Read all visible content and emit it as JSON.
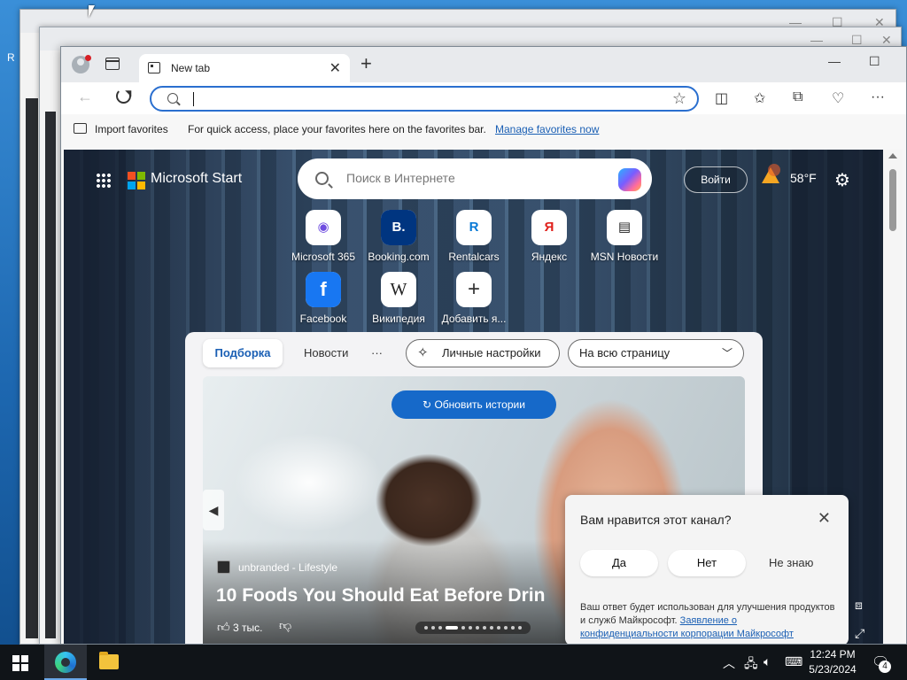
{
  "desktop": {
    "letter": "R"
  },
  "browser": {
    "tab": {
      "title": "New tab",
      "close": "✕"
    },
    "new_tab": "+",
    "window_controls": {
      "minimize": "—",
      "maximize": "☐"
    },
    "address": {
      "value": "",
      "placeholder": ""
    },
    "favorites_bar": {
      "import": "Import favorites",
      "hint": "For quick access, place your favorites here on the favorites bar.",
      "manage_link": "Manage favorites now"
    }
  },
  "msn": {
    "brand": "Microsoft Start",
    "search_placeholder": "Поиск в Интернете",
    "signin": "Войти",
    "weather_temp": "58°F",
    "shortcuts": [
      {
        "label": "Microsoft 365",
        "glyph": "◉",
        "color": "#6f4de0"
      },
      {
        "label": "Booking.com",
        "glyph": "B.",
        "color": "#003580"
      },
      {
        "label": "Rentalcars",
        "glyph": "R",
        "color": "#0a7ad6"
      },
      {
        "label": "Яндекс",
        "glyph": "Я",
        "color": "#e0201b"
      },
      {
        "label": "MSN Новости",
        "glyph": "▤",
        "color": "#222222"
      },
      {
        "label": "Facebook",
        "glyph": "f",
        "color": "#1877f2"
      },
      {
        "label": "Википедия",
        "glyph": "W",
        "color": "#222222"
      },
      {
        "label": "Добавить я...",
        "glyph": "+",
        "color": "#333333"
      }
    ],
    "feed_tabs": {
      "active": "Подборка",
      "news": "Новости",
      "more": "···"
    },
    "personalize": "Личные настройки",
    "layout_select": "На всю страницу",
    "refresh_stories": "Обновить истории",
    "story": {
      "source": "unbranded - Lifestyle",
      "headline": "10 Foods You Should Eat Before Drin",
      "likes": "3 тыс."
    },
    "feedback": {
      "question": "Вам нравится этот канал?",
      "yes": "Да",
      "no": "Нет",
      "dont_know": "Не знаю",
      "note": "Ваш ответ будет использован для улучшения продуктов и служб Майкрософт.",
      "privacy_link": "Заявление о конфиденциальности корпорации Майкрософт"
    }
  },
  "taskbar": {
    "time": "12:24 PM",
    "date": "5/23/2024",
    "notifications": "4"
  }
}
